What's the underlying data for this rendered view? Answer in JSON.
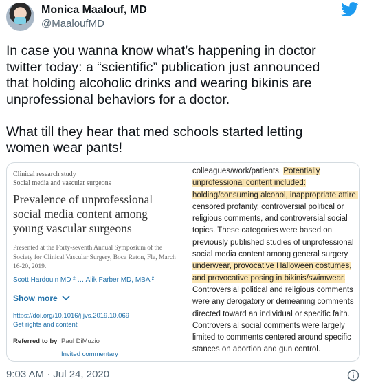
{
  "author": {
    "name": "Monica Maalouf, MD",
    "handle": "@MaaloufMD"
  },
  "tweet": {
    "text": "In case you wanna know what’s happening in doctor\ntwitter today: a “scientific” publication just announced\nthat holding alcoholic drinks and wearing bikinis are\nunprofessional behaviors for a doctor.\n\nWhat till they hear that med schools started letting\nwomen wear pants!",
    "timestamp": "9:03 AM · Jul 24, 2020"
  },
  "media": {
    "left": {
      "kicker_1": "Clinical research study",
      "kicker_2": "Social media and vascular surgeons",
      "title": "Prevalence of unprofessional social media content among young vascular surgeons",
      "presented": "Presented at the Forty-seventh Annual Symposium of the Society for Clinical Vascular Surgery, Boca Raton, Fla, March 16-20, 2019.",
      "authors": "Scott Hardouin MD ² … Alik Farber MD, MBA ²",
      "show_more": "Show more",
      "doi": "https://doi.org/10.1016/j.jvs.2019.10.069",
      "rights": "Get rights and content",
      "referred_label": "Referred to by",
      "referred_name": "Paul DiMuzio",
      "invited": "Invited commentary"
    },
    "right_lines": [
      {
        "pre": "colleagues/work/patients. ",
        "hl": "Potentially"
      },
      {
        "pre": "",
        "hl": "unprofessional content included:"
      },
      {
        "pre": "",
        "hl": "holding/consuming alcohol, inappropriate attire,"
      },
      {
        "pre": "censored profanity, controversial political or",
        "hl": ""
      },
      {
        "pre": "religious comments, and controversial social",
        "hl": ""
      },
      {
        "pre": "topics. These categories were based on",
        "hl": ""
      },
      {
        "pre": "previously published studies of unprofessional",
        "hl": ""
      },
      {
        "pre": "social media content among general surgery",
        "hl": ""
      },
      {
        "pre": "",
        "hl": "underwear, provocative Halloween costumes,"
      },
      {
        "pre": "",
        "hl": "and provocative posing in bikinis/swimwear."
      },
      {
        "pre": "Controversial political and religious comments",
        "hl": ""
      },
      {
        "pre": "were any derogatory or demeaning comments",
        "hl": ""
      },
      {
        "pre": "directed toward an individual or specific faith.",
        "hl": ""
      },
      {
        "pre": "Controversial social comments were largely",
        "hl": ""
      },
      {
        "pre": "limited to comments centered around specific",
        "hl": ""
      },
      {
        "pre": "stances on abortion and gun control.",
        "hl": ""
      }
    ]
  },
  "colors": {
    "twitter_blue": "#1d9bf0",
    "highlight": "#fbe6b4",
    "link": "#1f6fa8"
  },
  "icons": {
    "brand": "twitter-bird-icon",
    "info": "info-icon",
    "chevron": "chevron-down-icon"
  }
}
